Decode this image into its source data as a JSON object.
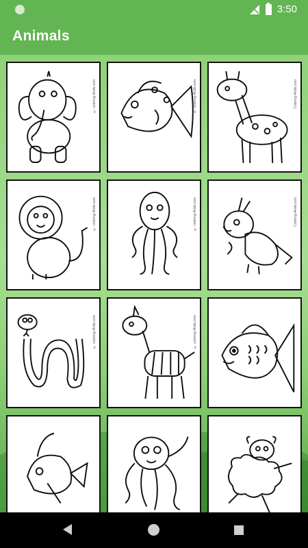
{
  "status_bar": {
    "time": "3:50"
  },
  "app_bar": {
    "title": "Animals"
  },
  "drawings": [
    {
      "animal": "elephant",
      "credit": "© coloring-4kids.com"
    },
    {
      "animal": "fish",
      "credit": "© coloring-4kids.com"
    },
    {
      "animal": "giraffe",
      "credit": "Coloring-4kids.com"
    },
    {
      "animal": "lion",
      "credit": "© coloring-4kids.com"
    },
    {
      "animal": "octopus",
      "credit": "© coloring-4kids.com"
    },
    {
      "animal": "parrot",
      "credit": "Coloring-4kids.com"
    },
    {
      "animal": "snake",
      "credit": "© coloring-4kids.com"
    },
    {
      "animal": "zebra",
      "credit": "© coloring-4kids.com"
    },
    {
      "animal": "fish",
      "credit": ""
    },
    {
      "animal": "fish",
      "credit": ""
    },
    {
      "animal": "octopus",
      "credit": ""
    },
    {
      "animal": "sheep",
      "credit": ""
    }
  ],
  "colors": {
    "app_bar": "#63b553",
    "background": "#8fd17a",
    "nav_bar": "#000000"
  }
}
